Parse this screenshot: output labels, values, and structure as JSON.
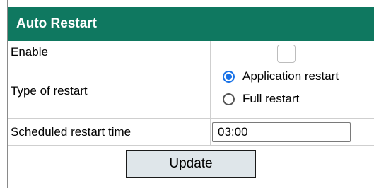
{
  "section": {
    "title": "Auto Restart"
  },
  "enable": {
    "label": "Enable",
    "checked": false
  },
  "restart_type": {
    "label": "Type of restart",
    "options": [
      {
        "label": "Application restart",
        "selected": true
      },
      {
        "label": "Full restart",
        "selected": false
      }
    ]
  },
  "scheduled": {
    "label": "Scheduled restart time",
    "value": "03:00"
  },
  "update_button": {
    "label": "Update"
  },
  "colors": {
    "header_bg": "#0f7860",
    "radio_accent": "#1a73e8",
    "button_bg": "#dfe6ea"
  }
}
